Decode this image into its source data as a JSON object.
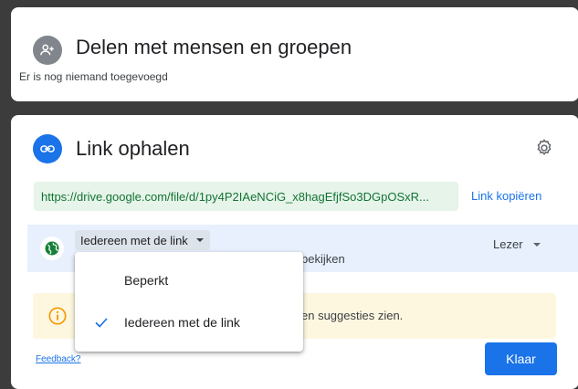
{
  "share_card": {
    "title": "Delen met mensen en groepen",
    "subtitle": "Er is nog niemand toegevoegd",
    "icon": "person-add-icon"
  },
  "link_card": {
    "title": "Link ophalen",
    "icon": "link-icon",
    "settings_icon": "gear-icon",
    "url": "https://drive.google.com/file/d/1py4P2IAeNCiG_x8hagEfjfSo3DGpOSxR...",
    "copy_label": "Link kopiëren",
    "access": {
      "icon": "globe-icon",
      "selected": "Iedereen met de link",
      "description_fragment": "bekijken",
      "role": "Lezer"
    },
    "info_icon": "info-icon",
    "info_fragment": "en suggesties zien.",
    "feedback_label": "Feedback?",
    "done_label": "Klaar"
  },
  "access_menu": {
    "items": [
      {
        "label": "Beperkt",
        "checked": false
      },
      {
        "label": "Iedereen met de link",
        "checked": true
      }
    ]
  },
  "colors": {
    "accent": "#1a73e8",
    "link_green": "#137333",
    "link_box_bg": "#e6f4ea",
    "access_row_bg": "#e8f0fe",
    "info_banner_bg": "#fef7e0",
    "info_icon": "#f29900"
  }
}
